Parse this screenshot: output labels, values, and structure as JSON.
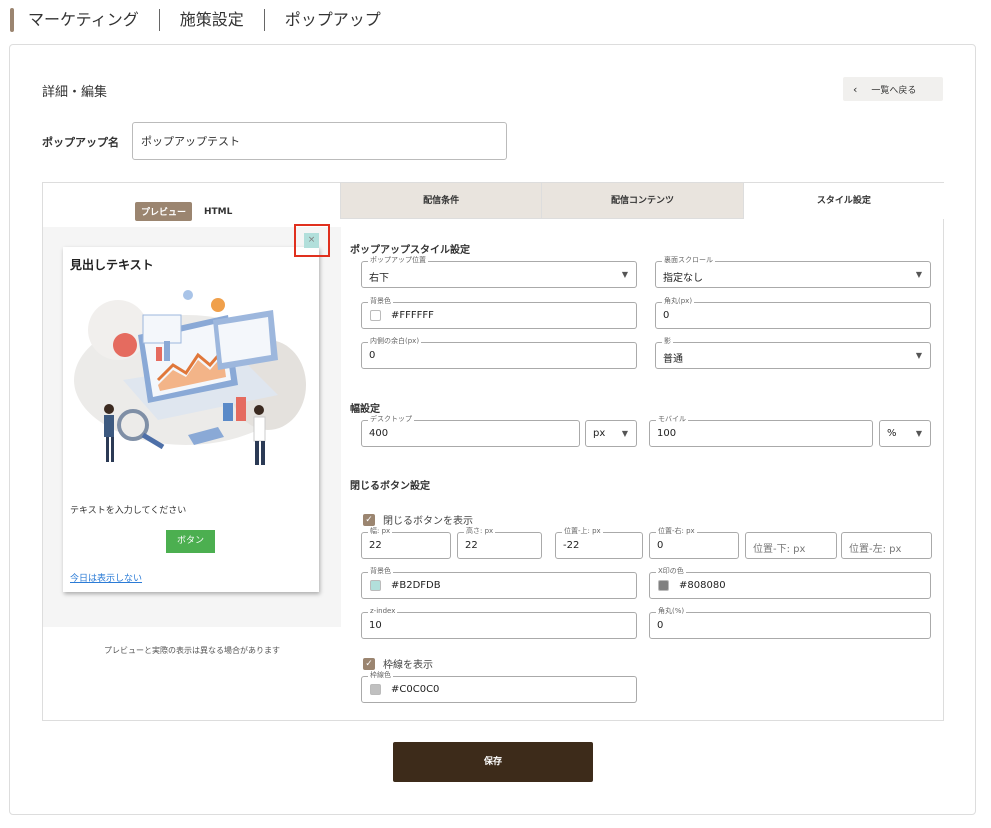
{
  "breadcrumb": [
    "マーケティング",
    "施策設定",
    "ポップアップ"
  ],
  "page": {
    "section_title": "詳細・編集",
    "back_button": "一覧へ戻る",
    "name_label": "ポップアップ名",
    "name_value": "ポップアップテスト",
    "save_button": "保存"
  },
  "preview": {
    "preview_tab": "プレビュー",
    "html_tab": "HTML",
    "close_glyph": "×",
    "popup_heading": "見出しテキスト",
    "popup_text": "テキストを入力してください",
    "popup_button": "ボタン",
    "popup_link": "今日は表示しない",
    "note": "プレビューと実際の表示は異なる場合があります"
  },
  "tabs": [
    "配信条件",
    "配信コンテンツ",
    "スタイル設定"
  ],
  "style": {
    "popup_style_title": "ポップアップスタイル設定",
    "position": {
      "label": "ポップアップ位置",
      "value": "右下"
    },
    "scroll": {
      "label": "裏面スクロール",
      "value": "指定なし"
    },
    "bg_color": {
      "label": "背景色",
      "value": "#FFFFFF",
      "swatch": "#FFFFFF"
    },
    "radius": {
      "label": "角丸(px)",
      "value": "0"
    },
    "padding": {
      "label": "内側の余白(px)",
      "value": "0"
    },
    "shadow": {
      "label": "影",
      "value": "普通"
    },
    "width_title": "幅設定",
    "desktop": {
      "label": "デスクトップ",
      "value": "400",
      "unit": "px"
    },
    "mobile": {
      "label": "モバイル",
      "value": "100",
      "unit": "%"
    },
    "close_title": "閉じるボタン設定",
    "show_close": "閉じるボタンを表示",
    "close_w": {
      "label": "幅: px",
      "value": "22"
    },
    "close_h": {
      "label": "高さ: px",
      "value": "22"
    },
    "close_top": {
      "label": "位置-上: px",
      "value": "-22"
    },
    "close_right": {
      "label": "位置-右: px",
      "value": "0"
    },
    "close_bottom": {
      "placeholder": "位置-下: px"
    },
    "close_left": {
      "placeholder": "位置-左: px"
    },
    "close_bg": {
      "label": "背景色",
      "value": "#B2DFDB",
      "swatch": "#B2DFDB"
    },
    "close_x_color": {
      "label": "X印の色",
      "value": "#808080",
      "swatch": "#808080"
    },
    "zindex": {
      "label": "z-index",
      "value": "10"
    },
    "close_radius": {
      "label": "角丸(%)",
      "value": "0"
    },
    "show_border": "枠線を表示",
    "border_color": {
      "label": "枠線色",
      "value": "#C0C0C0",
      "swatch": "#C0C0C0"
    }
  }
}
